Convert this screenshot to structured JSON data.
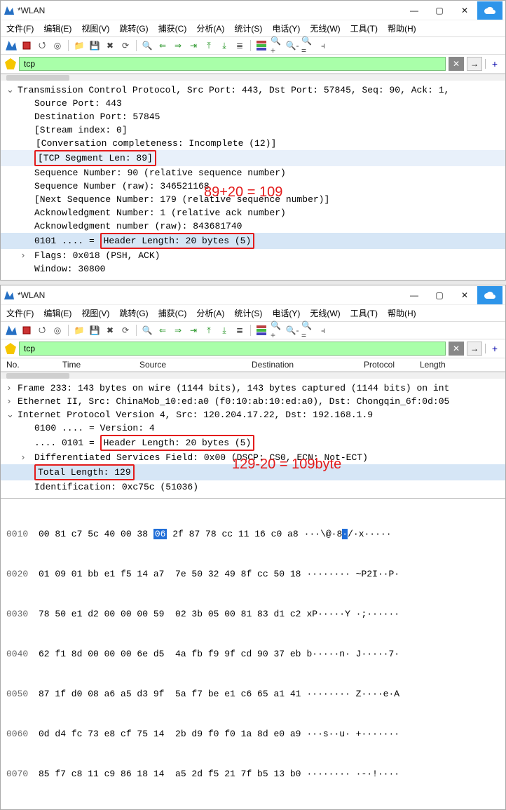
{
  "window1": {
    "title": "*WLAN",
    "menu": [
      "文件(F)",
      "编辑(E)",
      "视图(V)",
      "跳转(G)",
      "捕获(C)",
      "分析(A)",
      "统计(S)",
      "电话(Y)",
      "无线(W)",
      "工具(T)",
      "帮助(H)"
    ],
    "filter": "tcp",
    "annotation": "89+20 = 109",
    "detail": {
      "header": "Transmission Control Protocol, Src Port: 443, Dst Port: 57845, Seq: 90, Ack: 1,",
      "srcport": "Source Port: 443",
      "dstport": "Destination Port: 57845",
      "stream": "[Stream index: 0]",
      "conv": "[Conversation completeness: Incomplete (12)]",
      "seglen": "[TCP Segment Len: 89]",
      "seq": "Sequence Number: 90    (relative sequence number)",
      "seqraw": "Sequence Number (raw): 346521168",
      "nextseq": "[Next Sequence Number: 179    (relative sequence number)]",
      "ack": "Acknowledgment Number: 1    (relative ack number)",
      "ackraw": "Acknowledgment number (raw): 843681740",
      "hdrlen_pre": "0101 .... = ",
      "hdrlen": "Header Length: 20 bytes (5)",
      "flags": "Flags: 0x018 (PSH, ACK)",
      "window": "Window: 30800"
    }
  },
  "window2": {
    "title": "*WLAN",
    "menu": [
      "文件(F)",
      "编辑(E)",
      "视图(V)",
      "跳转(G)",
      "捕获(C)",
      "分析(A)",
      "统计(S)",
      "电话(Y)",
      "无线(W)",
      "工具(T)",
      "帮助(H)"
    ],
    "filter": "tcp",
    "columns": {
      "no": "No.",
      "time": "Time",
      "src": "Source",
      "dst": "Destination",
      "proto": "Protocol",
      "len": "Length"
    },
    "annotation": "129-20 = 109byte",
    "detail": {
      "frame": "Frame 233: 143 bytes on wire (1144 bits), 143 bytes captured (1144 bits) on int",
      "eth": "Ethernet II, Src: ChinaMob_10:ed:a0 (f0:10:ab:10:ed:a0), Dst: Chongqin_6f:0d:05",
      "ip": "Internet Protocol Version 4, Src: 120.204.17.22, Dst: 192.168.1.9",
      "ver": "0100 .... = Version: 4",
      "hdrlen_pre": ".... 0101 = ",
      "hdrlen": "Header Length: 20 bytes (5)",
      "dscp": "Differentiated Services Field: 0x00 (DSCP: CS0, ECN: Not-ECT)",
      "totlen": "Total Length: 129",
      "ident": "Identification: 0xc75c (51036)"
    },
    "hex": [
      {
        "off": "0010",
        "b1": "00 81 c7 5c 40 00 38 ",
        "sel": "06",
        "b2": " 2f 87 78 cc 11 16 c0 a8",
        "a1": "···\\@·8",
        "as": "·",
        "a2": "/·x·····"
      },
      {
        "off": "0020",
        "b": "01 09 01 bb e1 f5 14 a7  7e 50 32 49 8f cc 50 18",
        "a": "········ ~P2I··P·"
      },
      {
        "off": "0030",
        "b": "78 50 e1 d2 00 00 00 59  02 3b 05 00 81 83 d1 c2",
        "a": "xP·····Y ·;······"
      },
      {
        "off": "0040",
        "b": "62 f1 8d 00 00 00 6e d5  4a fb f9 9f cd 90 37 eb",
        "a": "b·····n· J·····7·"
      },
      {
        "off": "0050",
        "b": "87 1f d0 08 a6 a5 d3 9f  5a f7 be e1 c6 65 a1 41",
        "a": "········ Z····e·A"
      },
      {
        "off": "0060",
        "b": "0d d4 fc 73 e8 cf 75 14  2b d9 f0 f0 1a 8d e0 a9",
        "a": "···s··u· +·······"
      },
      {
        "off": "0070",
        "b": "85 f7 c8 11 c9 86 18 14  a5 2d f5 21 7f b5 13 b0",
        "a": "········ ·-·!····"
      }
    ]
  }
}
